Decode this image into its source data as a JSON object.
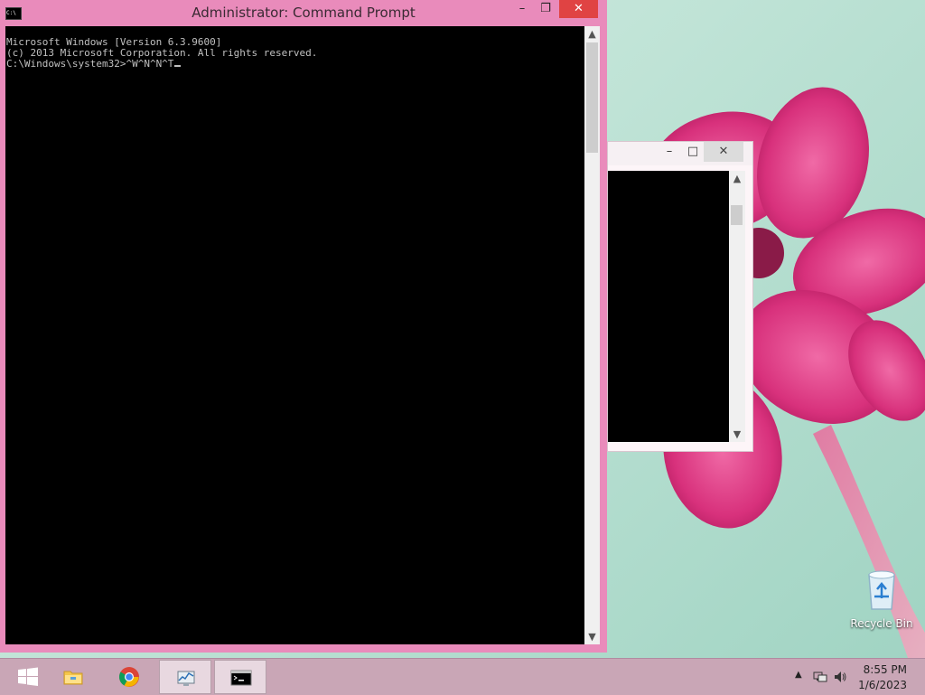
{
  "main_window": {
    "title": "Administrator:  Command Prompt",
    "minimize_glyph": "–",
    "maximize_glyph": "❐",
    "close_glyph": "✕",
    "console_lines": [
      "Microsoft Windows [Version 6.3.9600]",
      "(c) 2013 Microsoft Corporation. All rights reserved.",
      "",
      "C:\\Windows\\system32>^W^N^N^T"
    ]
  },
  "background_window": {
    "minimize_glyph": "–",
    "maximize_glyph": "□",
    "close_glyph": "✕"
  },
  "desktop": {
    "recycle_bin_label": "Recycle Bin"
  },
  "taskbar": {
    "apps": [
      {
        "name": "start",
        "icon": "windows-start-icon"
      },
      {
        "name": "file-explorer",
        "icon": "folder-icon"
      },
      {
        "name": "chrome",
        "icon": "chrome-icon"
      },
      {
        "name": "task-monitor",
        "icon": "performance-monitor-icon"
      },
      {
        "name": "command-prompt",
        "icon": "cmd-icon",
        "active": true
      }
    ],
    "clock": {
      "time": "8:55 PM",
      "date": "1/6/2023"
    }
  },
  "colors": {
    "window_frame": "#e98bbb",
    "close_button": "#e04343",
    "console_bg": "#000000",
    "console_text": "#c0c0c0",
    "taskbar": "#c9a6b6"
  }
}
